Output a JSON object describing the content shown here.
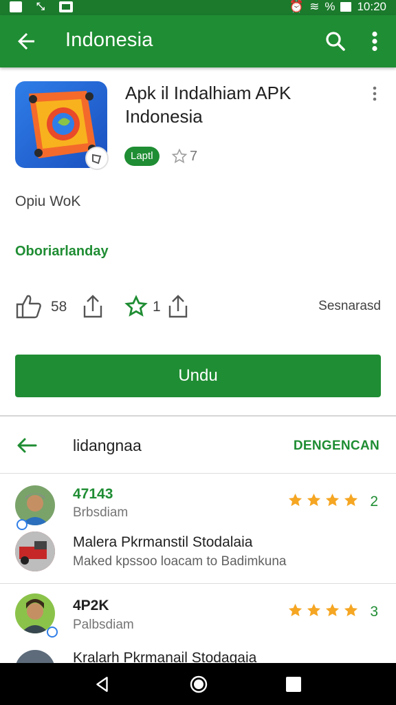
{
  "status_bar": {
    "time": "10:20",
    "signal_text": "%"
  },
  "app_bar": {
    "title": "Indonesia"
  },
  "app": {
    "name": "Apk il Indalhiam APK Indonesia",
    "version_badge": "Laptl",
    "rating": "7",
    "developer": "Opiu WoK",
    "category": "Oboriarlanday"
  },
  "stats": {
    "likes": "58",
    "stars": "1",
    "right_label": "Sesnarasd"
  },
  "install": {
    "label": "Undu"
  },
  "reviews_header": {
    "title": "lidangnaa",
    "more_label": "DENGENCAN"
  },
  "reviews": [
    {
      "name": "47143",
      "sub": "Brbsdiam",
      "rating": 4,
      "count": "2",
      "headline": "Malera Pkrmanstil Stodalaia",
      "body": "Maked kpssoo loacam to Badimkuna"
    },
    {
      "name": "4P2K",
      "sub": "Palbsdiam",
      "rating": 4,
      "count": "3",
      "headline": "Kralarh Pkrmanail Stodagaia",
      "body": ""
    }
  ],
  "colors": {
    "brand": "#1f8d33",
    "status": "#1b7a2c",
    "star": "#f5a623"
  },
  "icons": [
    "back-arrow-icon",
    "search-icon",
    "more-vert-icon",
    "thumbs-up-icon",
    "share-icon",
    "star-outline-icon",
    "home-icon",
    "recents-icon"
  ]
}
